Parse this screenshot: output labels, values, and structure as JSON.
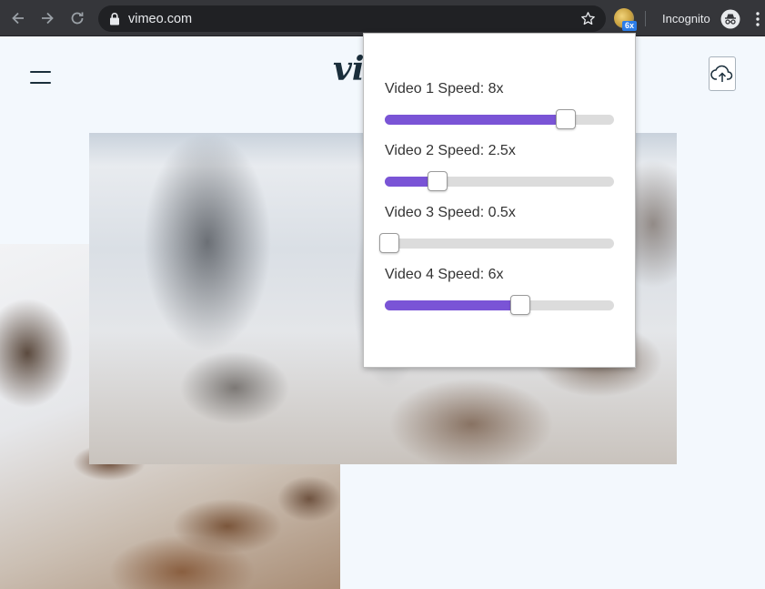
{
  "browser": {
    "url": "vimeo.com",
    "extension_badge": "6x",
    "incognito_label": "Incognito",
    "icons": [
      "back-arrow-icon",
      "forward-arrow-icon",
      "reload-icon",
      "lock-icon",
      "star-icon",
      "extension-icon",
      "incognito-icon",
      "kebab-menu-icon"
    ]
  },
  "site": {
    "logo_text": "vi",
    "icons": [
      "hamburger-menu-icon",
      "upload-cloud-icon"
    ]
  },
  "popup": {
    "sliders": [
      {
        "label": "Video 1 Speed: 8x",
        "fraction": 0.79
      },
      {
        "label": "Video 2 Speed: 2.5x",
        "fraction": 0.23
      },
      {
        "label": "Video 3 Speed: 0.5x",
        "fraction": 0.02
      },
      {
        "label": "Video 4 Speed: 6x",
        "fraction": 0.59
      }
    ],
    "accent_color": "#7a54d6"
  }
}
